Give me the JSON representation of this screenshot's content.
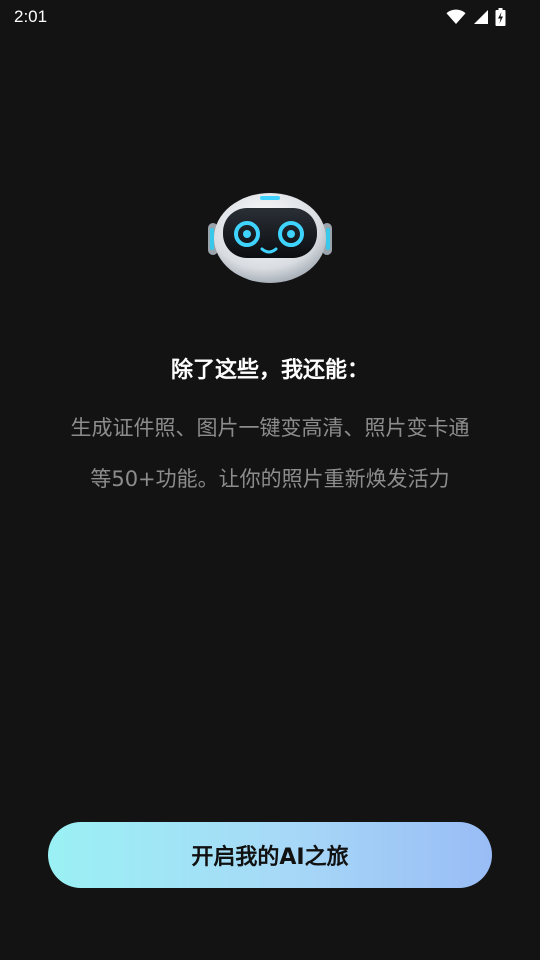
{
  "status_bar": {
    "time": "2:01",
    "icons": [
      "wifi-icon",
      "signal-icon",
      "battery-charging-icon"
    ]
  },
  "robot": {
    "icon": "robot-mascot-icon",
    "eye_color": "#3fd3ff"
  },
  "content": {
    "headline": "除了这些，我还能：",
    "description_line1": "生成证件照、图片一键变高清、照片变卡通",
    "description_line2": "等50+功能。让你的照片重新焕发活力"
  },
  "cta": {
    "label": "开启我的AI之旅",
    "gradient": [
      "#9af1f4",
      "#99bcf6"
    ]
  }
}
